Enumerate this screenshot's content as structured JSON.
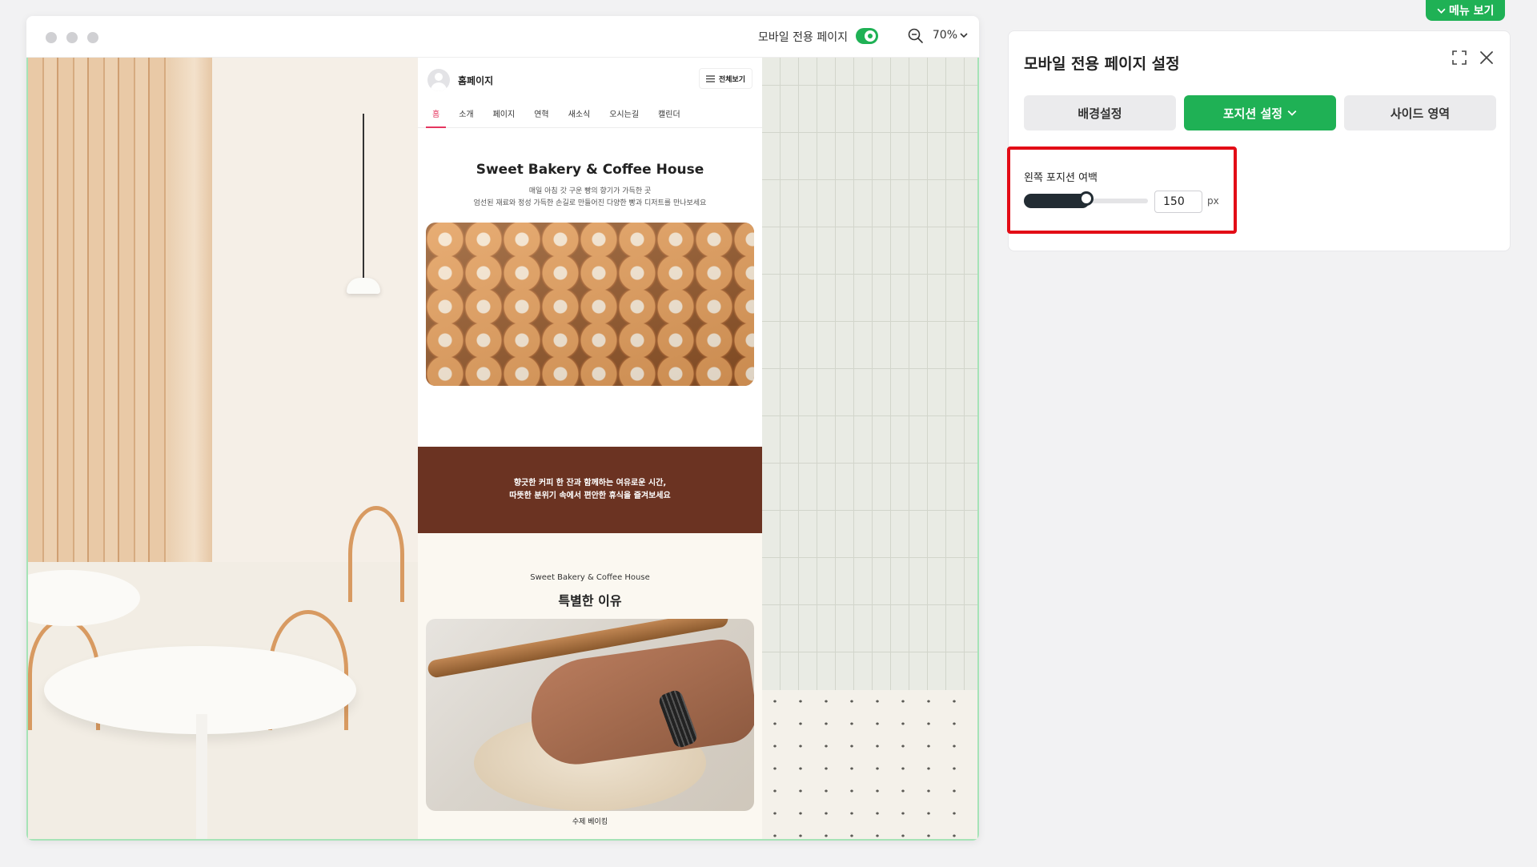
{
  "preview": {
    "mobile_only_label": "모바일 전용 페이지",
    "mobile_only_enabled": true,
    "zoom_value": "70%"
  },
  "mobile_page": {
    "site_name": "홈페이지",
    "menu_button": "전체보기",
    "tabs": [
      "홈",
      "소개",
      "페이지",
      "연혁",
      "새소식",
      "오시는길",
      "캘린더"
    ],
    "active_tab": "홈",
    "hero_title": "Sweet Bakery & Coffee House",
    "hero_sub_1": "매일 아침 갓 구운 빵의 향기가 가득한 곳",
    "hero_sub_2": "엄선된 재료와 정성 가득한 손길로 만들어진 다양한 빵과 디저트를 만나보세요",
    "band_line_1": "향긋한 커피 한 잔과 함께하는 여유로운 시간,",
    "band_line_2": "따뜻한 분위기 속에서 편안한 휴식을 즐겨보세요",
    "section_small": "Sweet Bakery & Coffee House",
    "section_title": "특별한 이유",
    "bottom_caption": "수제 베이킹"
  },
  "menu_view_button": "메뉴 보기",
  "panel": {
    "title": "모바일 전용 페이지 설정",
    "tabs": [
      "배경설정",
      "포지션 설정",
      "사이드 영역"
    ],
    "active_tab": "포지션 설정",
    "field_label": "왼쪽 포지션 여백",
    "slider_value": 150,
    "slider_fraction": 0.5,
    "input_value": "150",
    "unit": "px"
  },
  "colors": {
    "accent_green": "#1fb155",
    "highlight_red": "#e30c16",
    "tab_active_pink": "#e5355f",
    "band_brown": "#6b3322"
  }
}
